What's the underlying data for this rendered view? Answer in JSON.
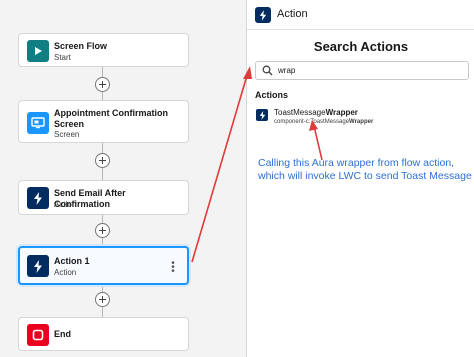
{
  "flow": {
    "nodes": [
      {
        "title": "Screen Flow",
        "subtitle": "Start",
        "icon": "play-icon",
        "color": "#107e82"
      },
      {
        "title": "Appointment Confirmation Screen",
        "subtitle": "Screen",
        "icon": "screen-icon",
        "color": "#1b96ff"
      },
      {
        "title": "Send Email After Confirmation",
        "subtitle": "Action",
        "icon": "lightning-icon",
        "color": "#032d60"
      },
      {
        "title": "Action 1",
        "subtitle": "Action",
        "icon": "lightning-icon",
        "color": "#032d60",
        "selected": true
      },
      {
        "title": "End",
        "subtitle": "",
        "icon": "stop-icon",
        "color": "#ea001e"
      }
    ]
  },
  "panel": {
    "title": "Action",
    "search_title": "Search Actions",
    "search_value": "wrap",
    "actions_heading": "Actions",
    "result": {
      "name_prefix": "ToastMessage",
      "name_match": "Wrapper",
      "api_prefix": "component-c:ToastMessage",
      "api_match": "Wrapper"
    }
  },
  "annotation": {
    "text": "Calling this Aura wrapper from flow action, which will invoke LWC to send Toast Message",
    "color": "#2f6fd6"
  },
  "arrow_color": "#e03a3a"
}
